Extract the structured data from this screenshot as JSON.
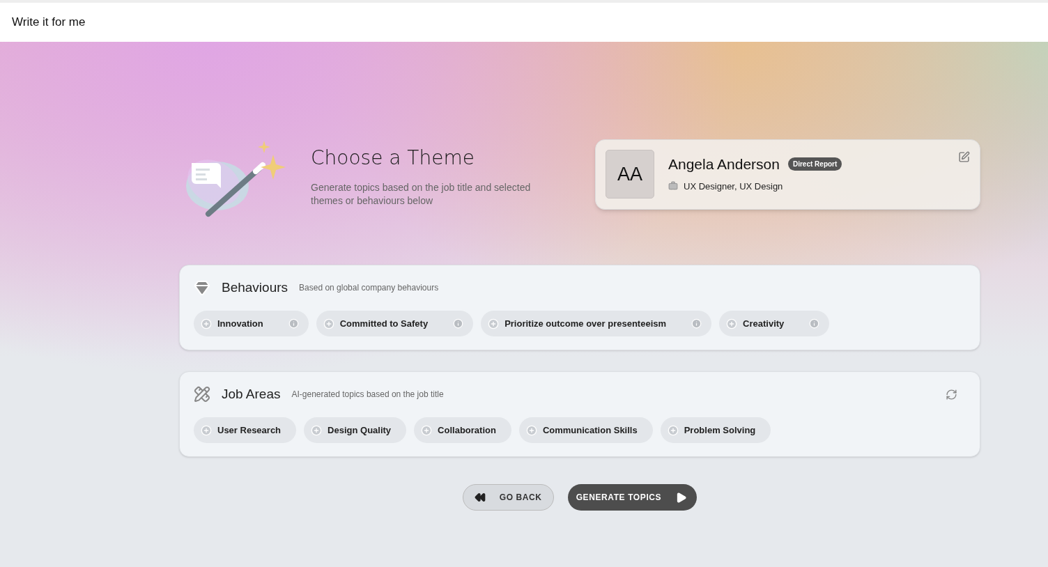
{
  "header": {
    "title": "Write it for me"
  },
  "hero": {
    "title": "Choose a Theme",
    "subtitle": "Generate topics based on the job title and selected themes or behaviours below"
  },
  "profile": {
    "initials": "AA",
    "name": "Angela Anderson",
    "badge": "Direct Report",
    "role": "UX Designer, UX Design"
  },
  "behaviours": {
    "title": "Behaviours",
    "subtitle": "Based on global company behaviours",
    "chips": [
      {
        "label": "Innovation"
      },
      {
        "label": "Committed to Safety"
      },
      {
        "label": "Prioritize outcome over presenteeism"
      },
      {
        "label": "Creativity"
      }
    ]
  },
  "job_areas": {
    "title": "Job Areas",
    "subtitle": "AI-generated topics based on the job title",
    "chips": [
      {
        "label": "User Research"
      },
      {
        "label": "Design Quality"
      },
      {
        "label": "Collaboration"
      },
      {
        "label": "Communication Skills"
      },
      {
        "label": "Problem Solving"
      }
    ]
  },
  "buttons": {
    "back": "GO BACK",
    "generate": "GENERATE TOPICS"
  }
}
